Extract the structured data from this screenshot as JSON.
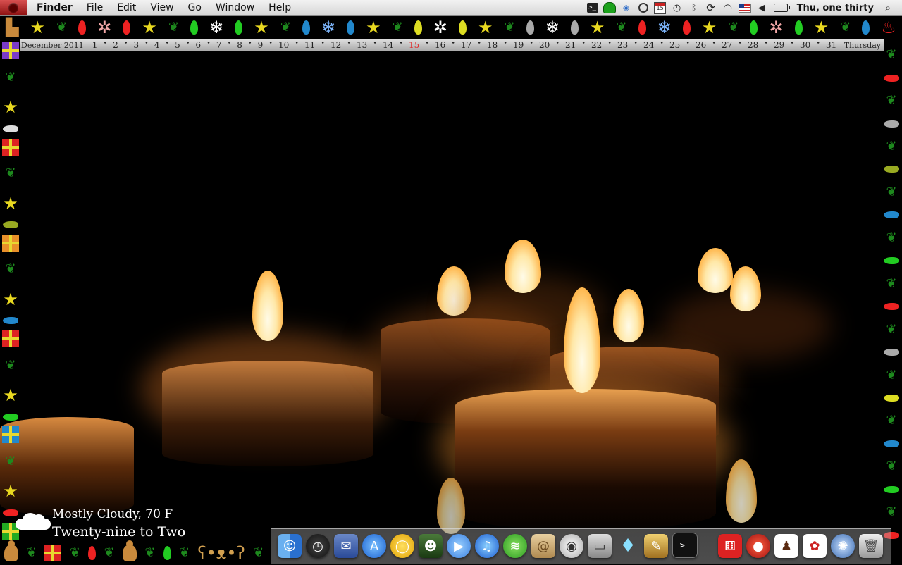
{
  "menubar": {
    "apple_icon": "apple-icon",
    "app_name": "Finder",
    "menus": [
      "File",
      "Edit",
      "View",
      "Go",
      "Window",
      "Help"
    ],
    "status_icons": [
      "terminal-icon",
      "mushroom-icon",
      "dropbox-icon",
      "sync-icon",
      "calendar-icon",
      "time-machine-icon",
      "bluetooth-icon",
      "refresh-icon",
      "wifi-icon",
      "us-flag-icon",
      "volume-icon",
      "battery-icon",
      "spotlight-icon"
    ],
    "calendar_icon_day": "15",
    "clock": "Thu, one thirty"
  },
  "calendar_strip": {
    "month": "December 2011",
    "days": [
      "1",
      "2",
      "3",
      "4",
      "5",
      "6",
      "7",
      "8",
      "9",
      "10",
      "11",
      "12",
      "13",
      "14",
      "15",
      "16",
      "17",
      "18",
      "19",
      "20",
      "21",
      "22",
      "23",
      "24",
      "25",
      "26",
      "27",
      "28",
      "29",
      "30",
      "31"
    ],
    "today": "15",
    "weekday": "Thursday"
  },
  "weather": {
    "condition": "Mostly Cloudy, 70 F",
    "fuzzy_time": "Twenty-nine to Two"
  },
  "dock": {
    "items": [
      {
        "name": "finder",
        "icon": "finder-icon"
      },
      {
        "name": "dashboard",
        "icon": "dashboard-icon"
      },
      {
        "name": "mail",
        "icon": "mail-icon"
      },
      {
        "name": "app-store",
        "icon": "app-store-icon"
      },
      {
        "name": "chrome",
        "icon": "chrome-icon"
      },
      {
        "name": "zombie-game",
        "icon": "zombie-icon"
      },
      {
        "name": "ichat",
        "icon": "ichat-icon"
      },
      {
        "name": "itunes",
        "icon": "itunes-icon"
      },
      {
        "name": "spotify",
        "icon": "spotify-icon"
      },
      {
        "name": "address-book",
        "icon": "address-book-icon"
      },
      {
        "name": "dvd-player",
        "icon": "dvd-icon"
      },
      {
        "name": "keynote",
        "icon": "keynote-icon"
      },
      {
        "name": "crystal",
        "icon": "crystal-icon"
      },
      {
        "name": "preview",
        "icon": "preview-icon"
      },
      {
        "name": "terminal",
        "icon": "terminal-icon"
      }
    ],
    "stacks": [
      {
        "name": "dice-stack",
        "icon": "dice-icon"
      },
      {
        "name": "button-stack",
        "icon": "red-button-icon"
      },
      {
        "name": "movie-stack",
        "icon": "movie-icon"
      },
      {
        "name": "pick-stack",
        "icon": "pick-icon"
      },
      {
        "name": "blue-orb-stack",
        "icon": "orb-icon"
      },
      {
        "name": "trash",
        "icon": "trash-icon"
      }
    ]
  }
}
